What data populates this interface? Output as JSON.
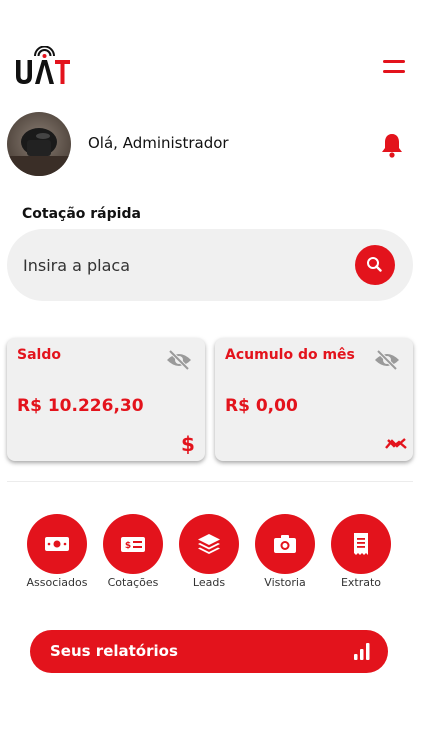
{
  "app": {
    "logo_text": "UAT",
    "accent_color": "#e3131c"
  },
  "header": {
    "menu_icon": "hamburger-menu-icon"
  },
  "profile": {
    "greeting": "Olá, Administrador",
    "notification_icon": "bell-icon"
  },
  "quick_quote": {
    "title": "Cotação rápida",
    "placeholder": "Insira a placa",
    "button_icon": "search-icon"
  },
  "cards": [
    {
      "title": "Saldo",
      "value": "R$ 10.226,30",
      "visibility_icon": "eye-slash-icon",
      "footer_icon": "dollar-icon"
    },
    {
      "title": "Acumulo do mês",
      "value": "R$ 0,00",
      "visibility_icon": "eye-slash-icon",
      "footer_icon": "trend-chart-icon"
    }
  ],
  "shortcuts": [
    {
      "label": "Associados",
      "icon": "money-bill-icon"
    },
    {
      "label": "Cotações",
      "icon": "dollar-card-icon"
    },
    {
      "label": "Leads",
      "icon": "layers-icon"
    },
    {
      "label": "Vistoria",
      "icon": "camera-icon"
    },
    {
      "label": "Extrato",
      "icon": "receipt-icon"
    }
  ],
  "reports": {
    "label": "Seus relatórios",
    "icon": "bar-chart-icon"
  }
}
